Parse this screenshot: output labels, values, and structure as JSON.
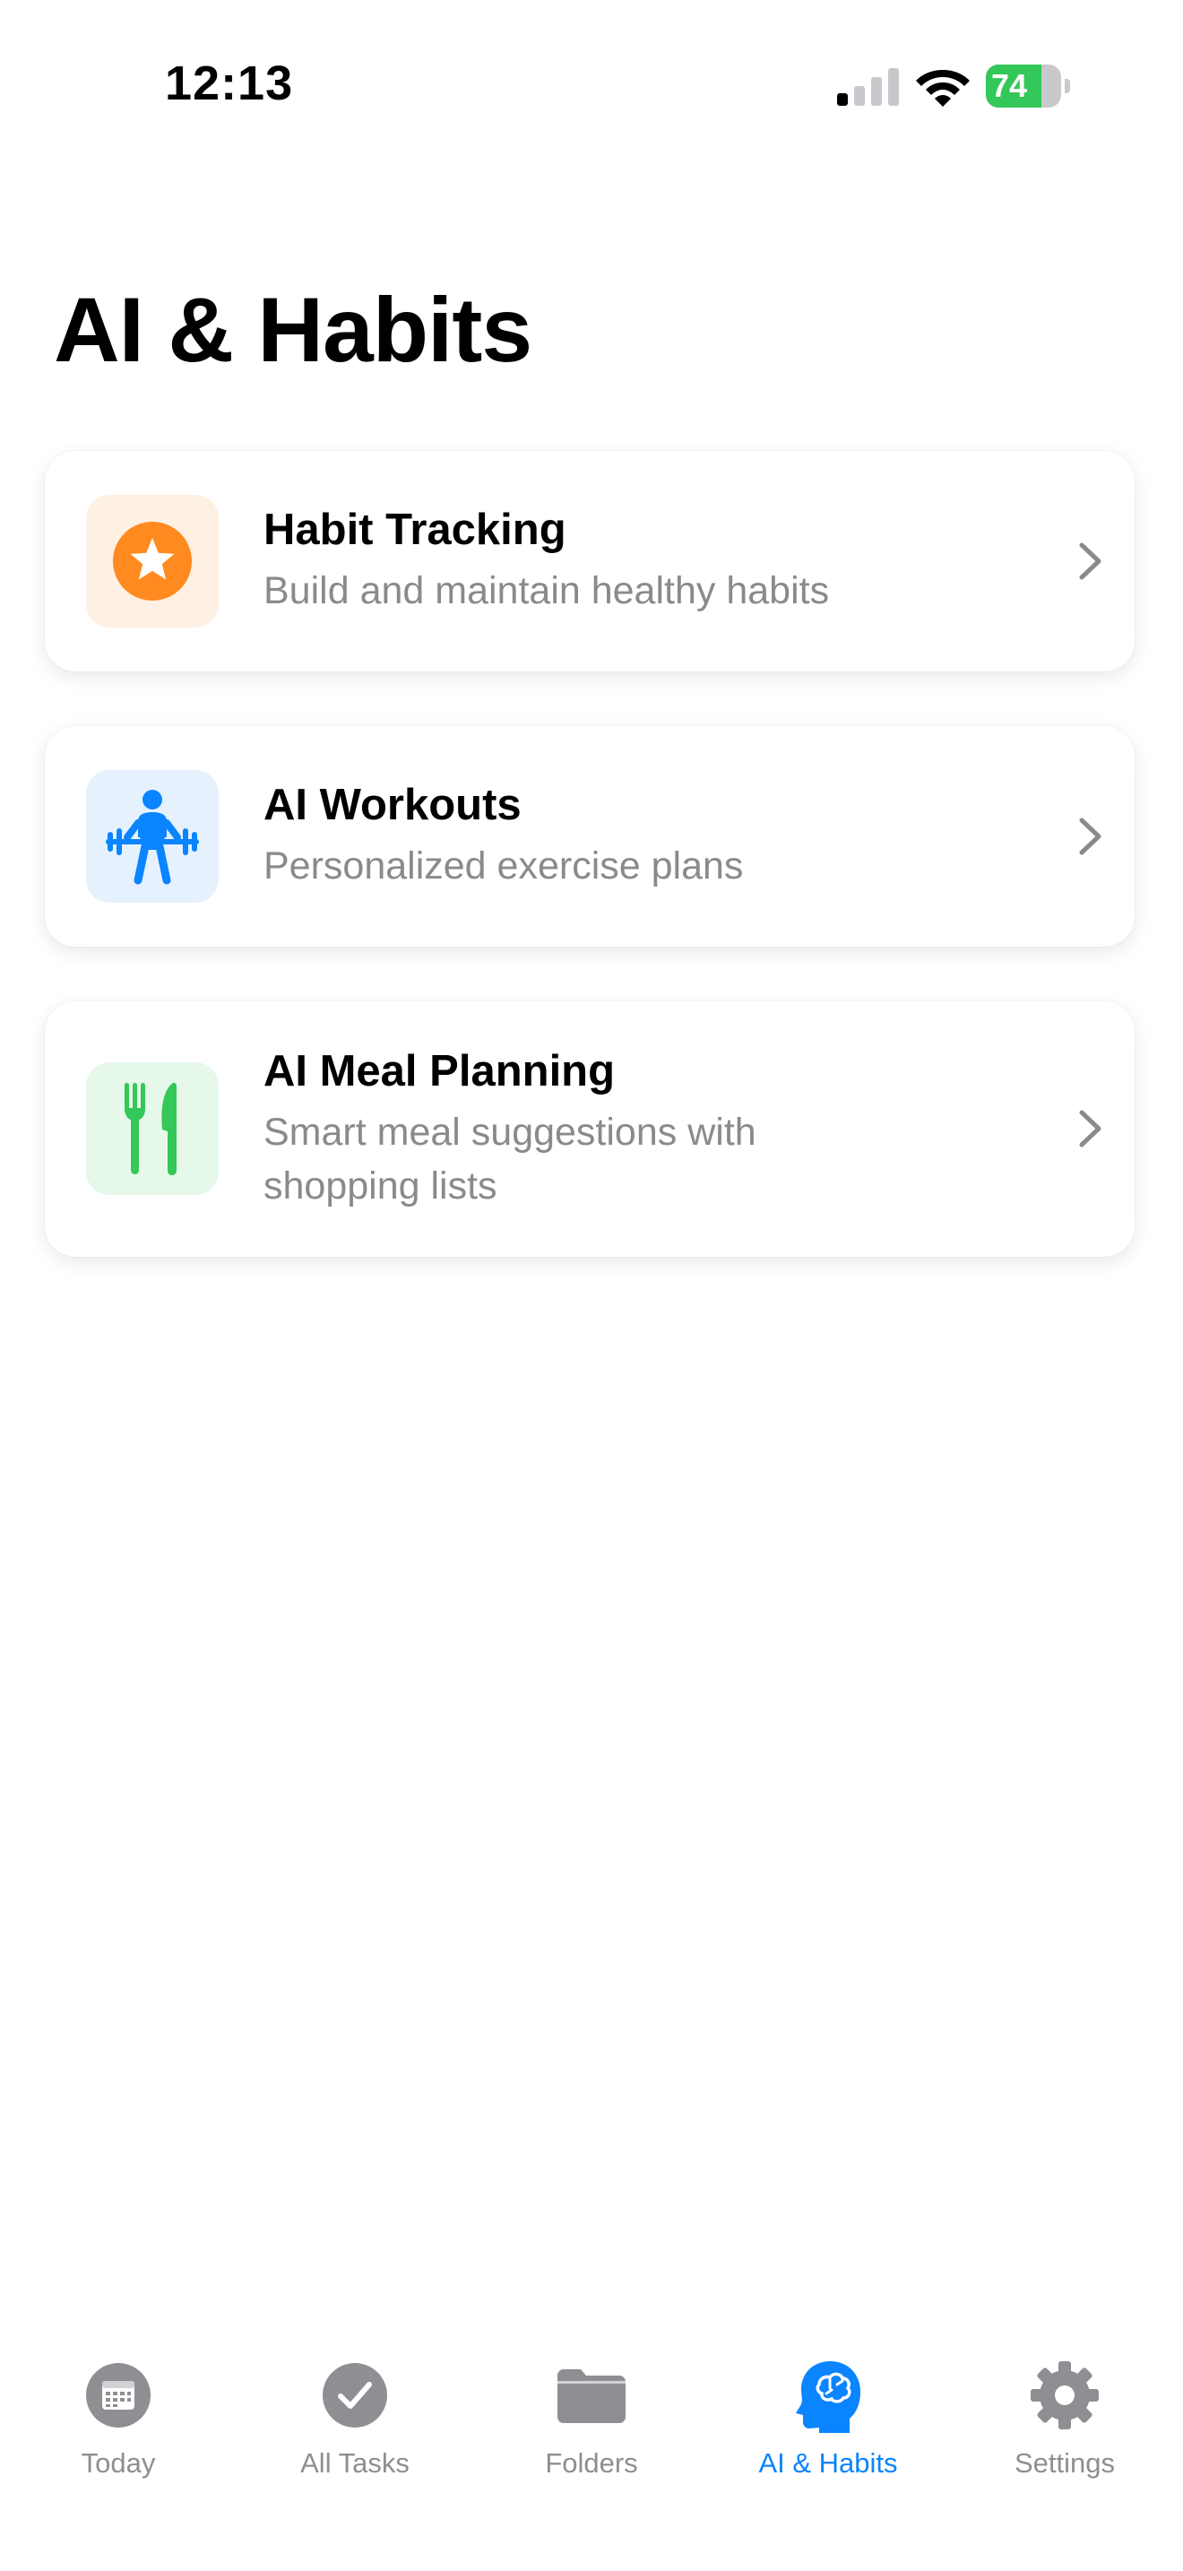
{
  "status_bar": {
    "time": "12:13",
    "battery": "74",
    "battery_level": 0.74
  },
  "page": {
    "title": "AI & Habits"
  },
  "cards": [
    {
      "title": "Habit Tracking",
      "subtitle": "Build and maintain healthy habits",
      "icon": "star-badge-icon",
      "color": "#ff8a1f",
      "bg": "#fff0e4"
    },
    {
      "title": "AI Workouts",
      "subtitle": "Personalized exercise plans",
      "icon": "weightlifter-icon",
      "color": "#0a84ff",
      "bg": "#e5f2fe"
    },
    {
      "title": "AI Meal Planning",
      "subtitle": "Smart meal suggestions with shopping lists",
      "icon": "fork-knife-icon",
      "color": "#34c759",
      "bg": "#e6f8ea"
    }
  ],
  "tabs": [
    {
      "label": "Today",
      "icon": "calendar-icon"
    },
    {
      "label": "All Tasks",
      "icon": "checkmark-circle-icon"
    },
    {
      "label": "Folders",
      "icon": "folder-icon"
    },
    {
      "label": "AI & Habits",
      "icon": "brain-head-icon",
      "active": true
    },
    {
      "label": "Settings",
      "icon": "gear-icon"
    }
  ],
  "colors": {
    "accent": "#0a84ff",
    "inactive": "#8e8e93",
    "battery": "#34c759"
  }
}
